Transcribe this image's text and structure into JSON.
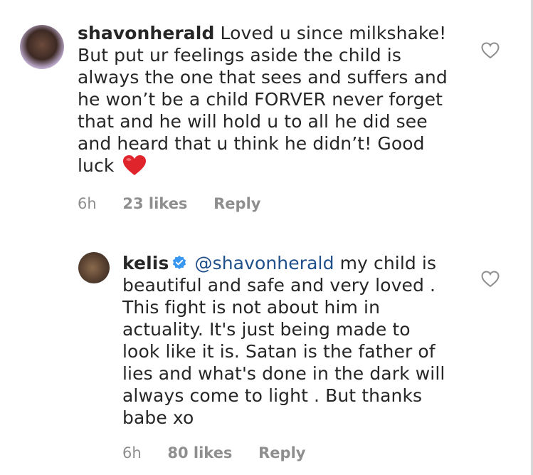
{
  "comments": [
    {
      "username": "shavonherald",
      "text": "Loved u since milkshake! But put ur feelings aside the child is always the one that sees and suffers and he won’t be a child FORVER never forget that and he will hold u to all he did see and heard that u think he didn’t! Good luck",
      "emoji": "red-heart",
      "time": "6h",
      "likes": "23 likes",
      "reply": "Reply",
      "avatar": "avatar"
    },
    {
      "username": "kelis",
      "verified": true,
      "mention": "@shavonherald",
      "text": "my child is beautiful and safe and very loved . This fight is not about him in actuality. It's just being made to look like it is. Satan is the father of lies and what's done in the dark will always come to light . But thanks babe xo",
      "time": "6h",
      "likes": "80 likes",
      "reply": "Reply",
      "avatar": "avatar"
    }
  ],
  "colors": {
    "mention": "#1e4f8a",
    "verified": "#3897f0",
    "meta": "#8e8e8e",
    "heart": "#e0242b"
  },
  "icons": {
    "like": "heart-outline-icon",
    "verified": "verified-badge-icon"
  }
}
